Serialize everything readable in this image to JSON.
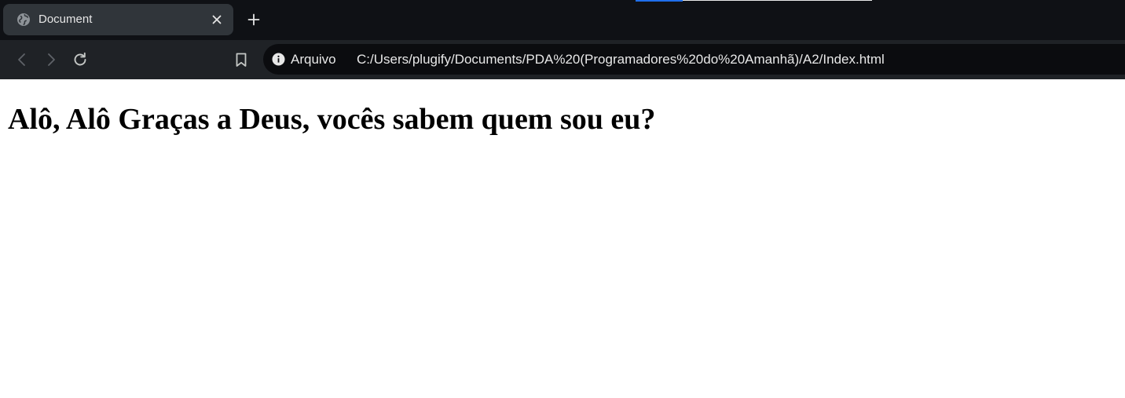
{
  "browser": {
    "tab": {
      "title": "Document",
      "favicon": "globe-icon",
      "close_icon": "close-icon"
    },
    "new_tab_icon": "plus-icon",
    "toolbar": {
      "back_icon": "chevron-left-icon",
      "forward_icon": "chevron-right-icon",
      "reload_icon": "reload-icon",
      "bookmark_icon": "bookmark-icon"
    },
    "omnibox": {
      "info_icon": "info-icon",
      "site_label": "Arquivo",
      "url": "C:/Users/plugify/Documents/PDA%20(Programadores%20do%20Amanhã)/A2/Index.html"
    }
  },
  "page": {
    "heading": "Alô, Alô Graças a Deus, vocês sabem quem sou eu?"
  },
  "colors": {
    "tabstrip_bg": "#0f1115",
    "active_tab_bg": "#30353a",
    "toolbar_bg": "#1f2226",
    "omnibox_bg": "#0b0c0f",
    "accent": "#1f6feb",
    "page_bg": "#ffffff",
    "heading_text": "#000000"
  }
}
